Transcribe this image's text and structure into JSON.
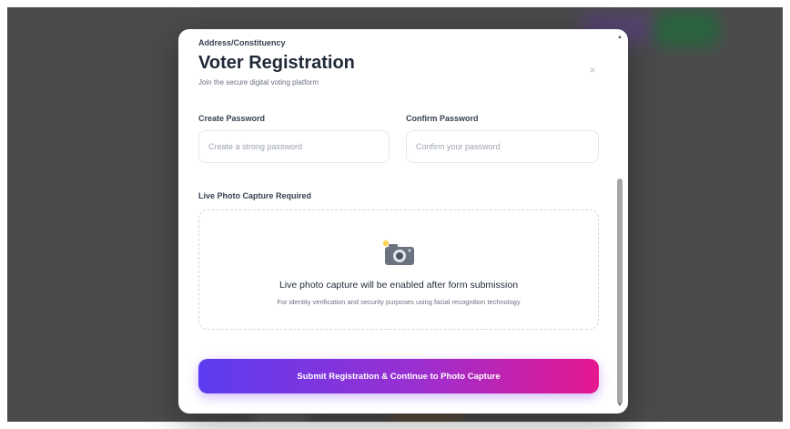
{
  "colors": {
    "accent_start": "#5b3cf0",
    "accent_end": "#e6178f",
    "title": "#1f2937",
    "backdrop": "#4b4b4b"
  },
  "modal": {
    "scrolled_label": "Address/Constituency",
    "title": "Voter Registration",
    "subtitle": "Join the secure digital voting platform",
    "close_icon": "×"
  },
  "form": {
    "create_password": {
      "label": "Create Password",
      "placeholder": "Create a strong password",
      "value": ""
    },
    "confirm_password": {
      "label": "Confirm Password",
      "placeholder": "Confirm your password",
      "value": ""
    },
    "photo": {
      "label": "Live Photo Capture Required",
      "icon": "camera-icon",
      "heading": "Live photo capture will be enabled after form submission",
      "description": "For identity verification and security purposes using facial recognition technology"
    },
    "submit_label": "Submit Registration & Continue to Photo Capture"
  },
  "scrollbar": {
    "up_arrow": "▲",
    "down_arrow": "▼"
  }
}
